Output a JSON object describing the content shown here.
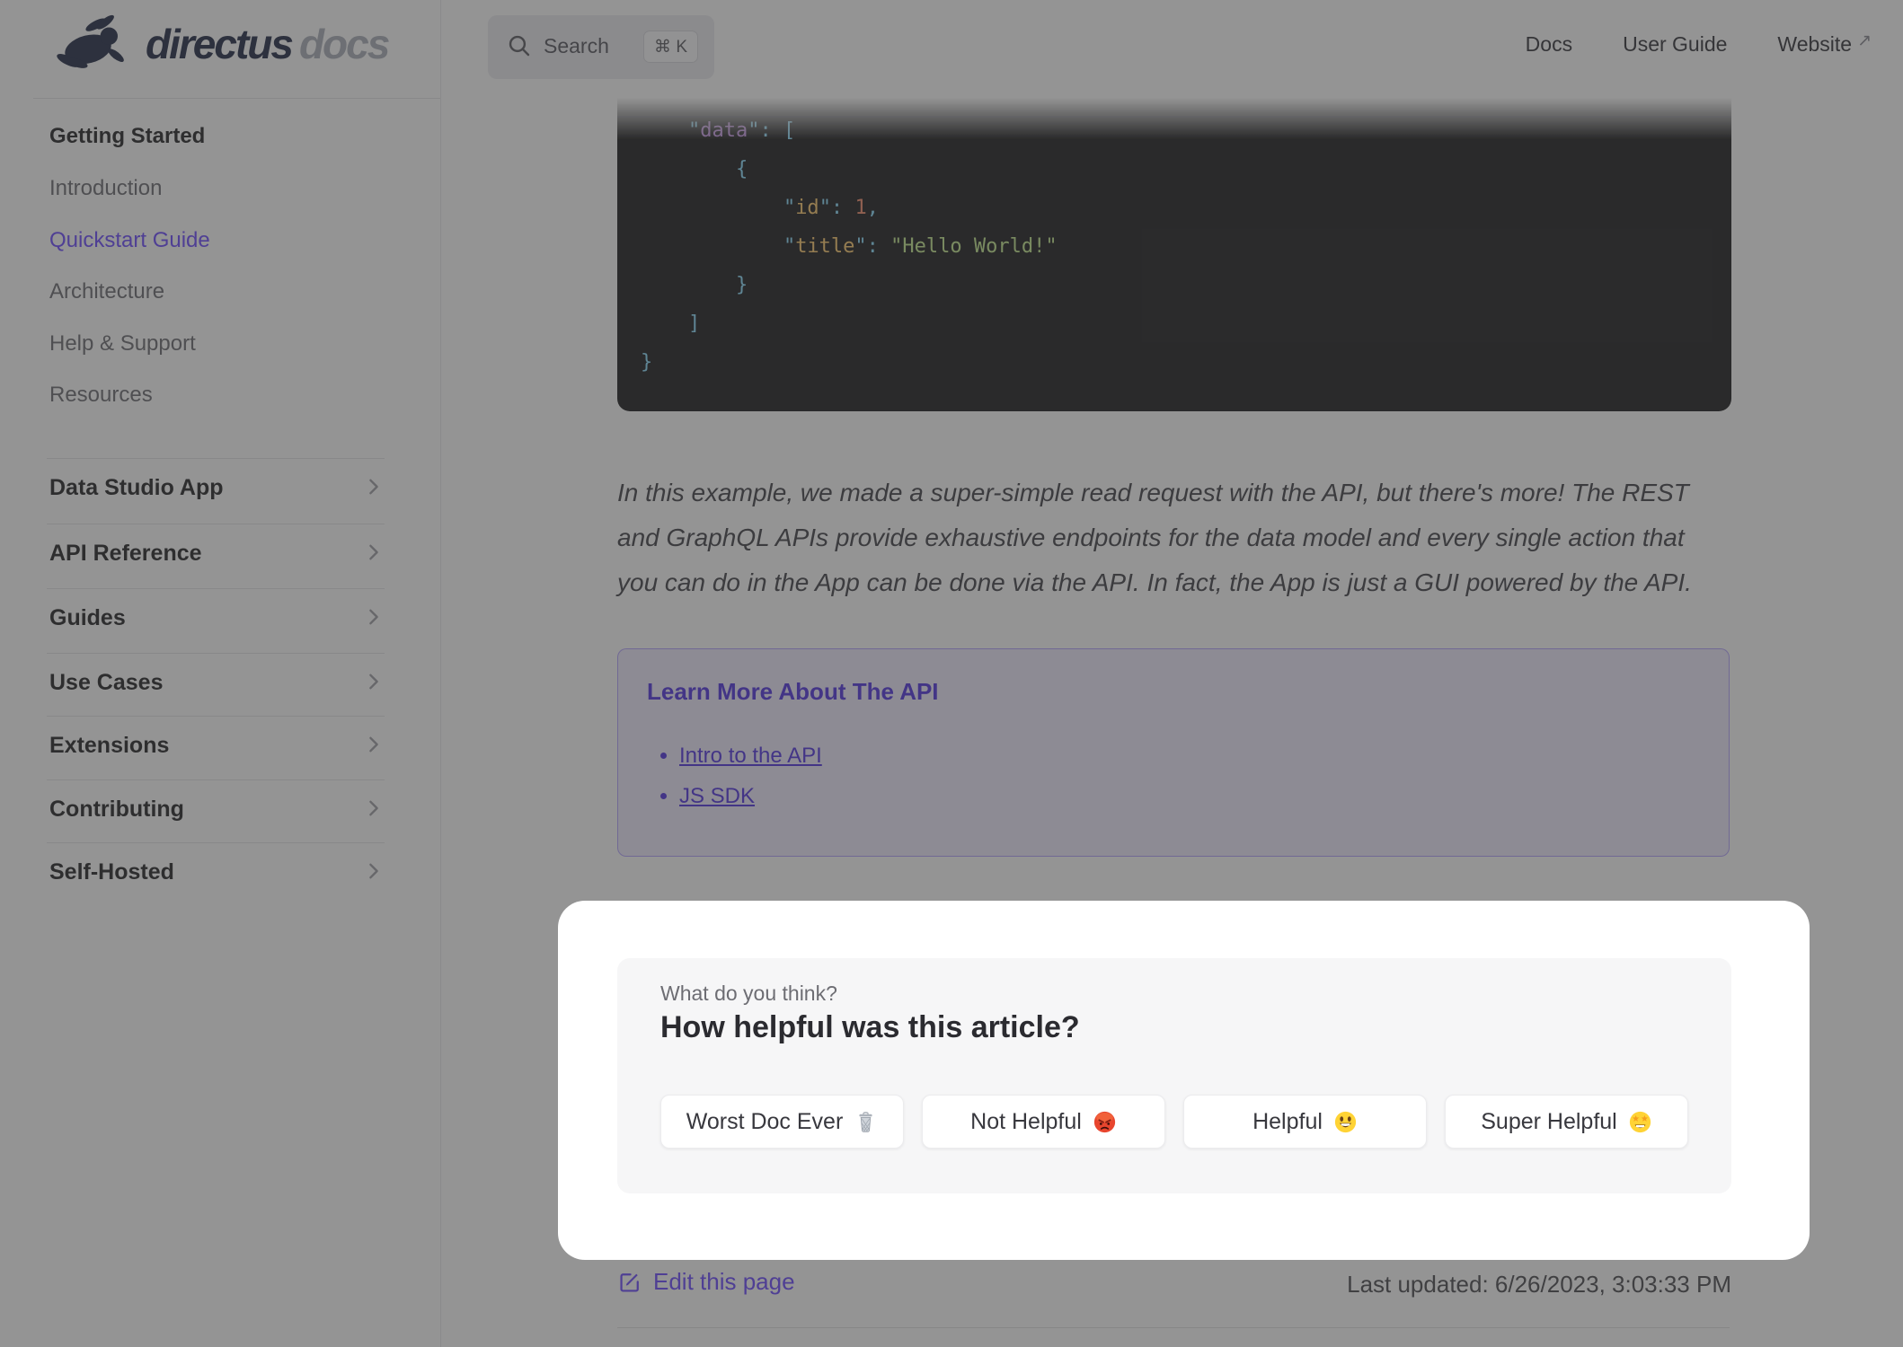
{
  "logo": {
    "brand": "directus",
    "suffix": "docs"
  },
  "header": {
    "search_label": "Search",
    "search_shortcut": "⌘ K",
    "nav": [
      {
        "label": "Docs"
      },
      {
        "label": "User Guide"
      },
      {
        "label": "Website",
        "arrow": "↗"
      }
    ]
  },
  "sidebar": {
    "section_title": "Getting Started",
    "links": [
      "Introduction",
      "Quickstart Guide",
      "Architecture",
      "Help & Support",
      "Resources"
    ],
    "active_link": "Quickstart Guide",
    "groups": [
      "Data Studio App",
      "API Reference",
      "Guides",
      "Use Cases",
      "Extensions",
      "Contributing",
      "Self-Hosted"
    ]
  },
  "code_block": {
    "language": "json",
    "lines": [
      [
        {
          "t": "    \"",
          "c": "#89ddff"
        },
        {
          "t": "data",
          "c": "#c792ea"
        },
        {
          "t": "\": ",
          "c": "#89ddff"
        },
        {
          "t": "[",
          "c": "#89ddff"
        }
      ],
      [
        {
          "t": "        {",
          "c": "#89ddff"
        }
      ],
      [
        {
          "t": "            \"",
          "c": "#89ddff"
        },
        {
          "t": "id",
          "c": "#ffcb6b"
        },
        {
          "t": "\": ",
          "c": "#89ddff"
        },
        {
          "t": "1",
          "c": "#f78c6c"
        },
        {
          "t": ",",
          "c": "#89ddff"
        }
      ],
      [
        {
          "t": "            \"",
          "c": "#89ddff"
        },
        {
          "t": "title",
          "c": "#ffcb6b"
        },
        {
          "t": "\": ",
          "c": "#89ddff"
        },
        {
          "t": "\"Hello World!\"",
          "c": "#c3e88d"
        }
      ],
      [
        {
          "t": "        }",
          "c": "#89ddff"
        }
      ],
      [
        {
          "t": "    ]",
          "c": "#89ddff"
        }
      ],
      [
        {
          "t": "}",
          "c": "#89ddff"
        }
      ]
    ]
  },
  "article": {
    "paragraph": "In this example, we made a super-simple read request with the API, but there's more! The REST and GraphQL APIs provide exhaustive endpoints for the data model and every single action that you can do in the App can be done via the API. In fact, the App is just a GUI powered by the API."
  },
  "info_box": {
    "title": "Learn More About The API",
    "links": [
      "Intro to the API",
      "JS SDK"
    ]
  },
  "feedback": {
    "eyebrow": "What do you think?",
    "question": "How helpful was this article?",
    "options": [
      {
        "label": "Worst Doc Ever",
        "emoji": "wastebasket-emoji"
      },
      {
        "label": "Not Helpful",
        "emoji": "angry-face-emoji"
      },
      {
        "label": "Helpful",
        "emoji": "grinning-face-emoji"
      },
      {
        "label": "Super Helpful",
        "emoji": "star-struck-emoji"
      }
    ]
  },
  "footer": {
    "edit_label": "Edit this page",
    "last_updated": "Last updated: 6/26/2023, 3:03:33 PM"
  },
  "colors": {
    "accent": "#6644ff",
    "overlay": "rgba(60,60,60,0.55)",
    "code_background": "#161618",
    "code_tokens": {
      "punctuation": "#89ddff",
      "key_top": "#c792ea",
      "key_nested": "#ffcb6b",
      "number": "#f78c6c",
      "string": "#c3e88d"
    },
    "spotlight": "#ffffff",
    "card_background": "#f6f6f7"
  }
}
